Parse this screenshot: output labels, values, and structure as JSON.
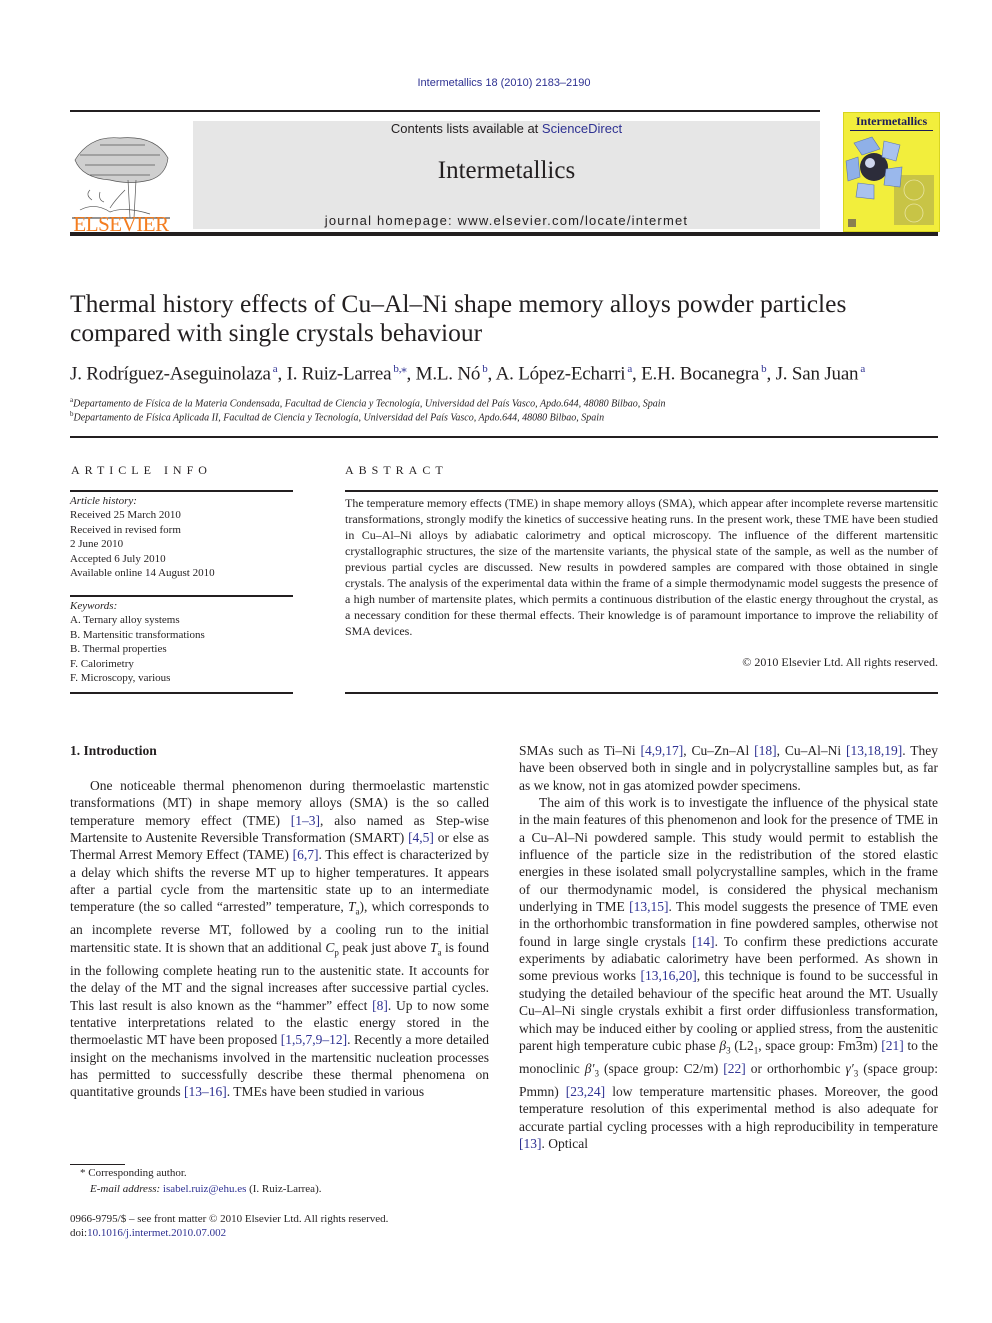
{
  "header": {
    "journal_ref": "Intermetallics 18 (2010) 2183–2190",
    "contents_prefix": "Contents lists available at ",
    "contents_link": "ScienceDirect",
    "journal_name": "Intermetallics",
    "homepage": "journal homepage: www.elsevier.com/locate/intermet",
    "publisher_logo_text": "ELSEVIER",
    "cover_title": "Intermetallics",
    "colors": {
      "publisher_orange": "#f47d1f",
      "link_blue": "#2e3192",
      "masthead_gray": "#e6e6e6",
      "cover_yellow": "#f2ee3c"
    }
  },
  "article": {
    "title_line1": "Thermal history effects of Cu–Al–Ni shape memory alloys powder particles",
    "title_line2": "compared with single crystals behaviour",
    "authors": [
      {
        "name": "J. Rodríguez-Aseguinolaza",
        "affil": "a"
      },
      {
        "name": "I. Ruiz-Larrea",
        "affil": "b,⁎"
      },
      {
        "name": "M.L. Nó",
        "affil": "b"
      },
      {
        "name": "A. López-Echarri",
        "affil": "a"
      },
      {
        "name": "E.H. Bocanegra",
        "affil": "b"
      },
      {
        "name": "J. San Juan",
        "affil": "a"
      }
    ],
    "affiliations": [
      {
        "key": "a",
        "text": "Departamento de Física de la Materia Condensada, Facultad de Ciencia y Tecnología, Universidad del País Vasco, Apdo.644, 48080 Bilbao, Spain"
      },
      {
        "key": "b",
        "text": "Departamento de Física Aplicada II, Facultad de Ciencia y Tecnología, Universidad del País Vasco, Apdo.644, 48080 Bilbao, Spain"
      }
    ]
  },
  "article_info": {
    "heading": "ARTICLE INFO",
    "history_label": "Article history:",
    "history": [
      "Received 25 March 2010",
      "Received in revised form",
      "2 June 2010",
      "Accepted 6 July 2010",
      "Available online 14 August 2010"
    ],
    "keywords_label": "Keywords:",
    "keywords": [
      "A. Ternary alloy systems",
      "B. Martensitic transformations",
      "B. Thermal properties",
      "F. Calorimetry",
      "F. Microscopy, various"
    ]
  },
  "abstract": {
    "heading": "ABSTRACT",
    "text": "The temperature memory effects (TME) in shape memory alloys (SMA), which appear after incomplete reverse martensitic transformations, strongly modify the kinetics of successive heating runs. In the present work, these TME have been studied in Cu–Al–Ni alloys by adiabatic calorimetry and optical microscopy. The influence of the different martensitic crystallographic structures, the size of the martensite variants, the physical state of the sample, as well as the number of previous partial cycles are discussed. New results in powdered samples are compared with those obtained in single crystals. The analysis of the experimental data within the frame of a simple thermodynamic model suggests the presence of a high number of martensite plates, which permits a continuous distribution of the elastic energy throughout the crystal, as a necessary condition for these thermal effects. Their knowledge is of paramount importance to improve the reliability of SMA devices.",
    "copyright": "© 2010 Elsevier Ltd. All rights reserved."
  },
  "body": {
    "section_heading": "1.  Introduction",
    "left_column": [
      {
        "t": "One noticeable thermal phenomenon during thermoelastic martenstic transformations (MT) in shape memory alloys (SMA) is the so called temperature memory effect (TME) "
      },
      {
        "r": "[1–3]"
      },
      {
        "t": ", also named as Step-wise Martensite to Austenite Reversible Transformation (SMART) "
      },
      {
        "r": "[4,5]"
      },
      {
        "t": " or else as Thermal Arrest Memory Effect (TAME) "
      },
      {
        "r": "[6,7]"
      },
      {
        "t": ". This effect is characterized by a delay which shifts the reverse MT up to higher temperatures. It appears after a partial cycle from the martensitic state up to an intermediate temperature (the so called “arrested” temperature, "
      },
      {
        "i": "T",
        "s": "a"
      },
      {
        "t": "), which corresponds to an incomplete reverse MT, followed by a cooling run to the initial martensitic state. It is shown that an additional "
      },
      {
        "i": "C",
        "s": "p"
      },
      {
        "t": " peak just above "
      },
      {
        "i": "T",
        "s": "a"
      },
      {
        "t": " is found in the following complete heating run to the austenitic state. It accounts for the delay of the MT and the signal increases after successive partial cycles. This last result is also known as the “hammer” effect "
      },
      {
        "r": "[8]"
      },
      {
        "t": ". Up to now some tentative interpretations related to the elastic energy stored in the thermoelastic MT have been proposed "
      },
      {
        "r": "[1,5,7,9–12]"
      },
      {
        "t": ". Recently a more detailed insight on the mechanisms involved in the martensitic nucleation processes has permitted to successfully describe these thermal phenomena on quantitative grounds "
      },
      {
        "r": "[13–16]"
      },
      {
        "t": ". TMEs have been studied in various"
      }
    ],
    "right_column_p1": [
      {
        "t": "SMAs such as Ti–Ni "
      },
      {
        "r": "[4,9,17]"
      },
      {
        "t": ", Cu–Zn–Al "
      },
      {
        "r": "[18]"
      },
      {
        "t": ", Cu–Al–Ni "
      },
      {
        "r": "[13,18,19]"
      },
      {
        "t": ". They have been observed both in single and in polycrystalline samples but, as far as we know, not in gas atomized powder specimens."
      }
    ],
    "right_column_p2": [
      {
        "t": "The aim of this work is to investigate the influence of the physical state in the main features of this phenomenon and look for the presence of TME in a Cu–Al–Ni powdered sample. This study would permit to establish the influence of the particle size in the redistribution of the stored elastic energies in these isolated small polycrystalline samples, which in the frame of our thermodynamic model, is considered the physical mechanism underlying in TME "
      },
      {
        "r": "[13,15]"
      },
      {
        "t": ". This model suggests the presence of TME even in the orthorhombic transformation in fine powdered samples, otherwise not found in large single crystals "
      },
      {
        "r": "[14]"
      },
      {
        "t": ". To confirm these predictions accurate experiments by adiabatic calorimetry have been performed. As shown in some previous works "
      },
      {
        "r": "[13,16,20]"
      },
      {
        "t": ", this technique is found to be successful in studying the detailed behaviour of the specific heat around the MT. Usually Cu–Al–Ni single crystals exhibit a first order diffusionless transformation, which may be induced either by cooling or applied stress, from the austenitic parent high temperature cubic phase "
      },
      {
        "i": "β",
        "s": "3"
      },
      {
        "t": " (L2"
      },
      {
        "sub": "1"
      },
      {
        "t": ", space group: Fm"
      },
      {
        "over": "3"
      },
      {
        "t": "m) "
      },
      {
        "r": "[21]"
      },
      {
        "t": " to the monoclinic "
      },
      {
        "i": "β′",
        "s": "3"
      },
      {
        "t": " (space group: C2/m) "
      },
      {
        "r": "[22]"
      },
      {
        "t": " or orthorhombic "
      },
      {
        "i": "γ′",
        "s": "3"
      },
      {
        "t": " (space group: Pmmn) "
      },
      {
        "r": "[23,24]"
      },
      {
        "t": " low temperature martensitic phases. Moreover, the good temperature resolution of this experimental method is also adequate for accurate partial cycling processes with a high reproducibility in temperature "
      },
      {
        "r": "[13]"
      },
      {
        "t": ". Optical"
      }
    ]
  },
  "footnotes": {
    "corresponding_marker": "*",
    "corresponding_text": "Corresponding author.",
    "email_label": "E-mail address:",
    "email": "isabel.ruiz@ehu.es",
    "email_suffix": " (I. Ruiz-Larrea).",
    "issn_line": "0966-9795/$ – see front matter © 2010 Elsevier Ltd. All rights reserved.",
    "doi_label": "doi:",
    "doi": "10.1016/j.intermet.2010.07.002"
  }
}
